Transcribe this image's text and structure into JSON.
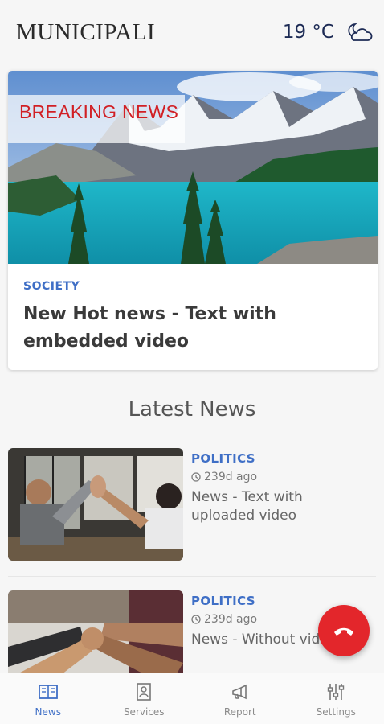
{
  "header": {
    "brand": "MUNICIPALI",
    "temperature": "19 °C",
    "weather_icon": "partly-cloudy-night-icon"
  },
  "hero": {
    "badge": "BREAKING NEWS",
    "category": "SOCIETY",
    "title": "New Hot news - Text with embedded video",
    "image": "mountain-lake-photo"
  },
  "latest": {
    "heading": "Latest News",
    "items": [
      {
        "category": "POLITICS",
        "time": "239d ago",
        "title": "News - Text with uploaded video",
        "image": "team-high-five-photo"
      },
      {
        "category": "POLITICS",
        "time": "239d ago",
        "title": "News - Without video",
        "image": "fist-bump-photo"
      }
    ]
  },
  "fab": {
    "icon": "phone-hangup-icon",
    "color": "#e3262b"
  },
  "nav": {
    "items": [
      {
        "label": "News",
        "icon": "newspaper-icon",
        "active": true
      },
      {
        "label": "Services",
        "icon": "contact-card-icon",
        "active": false
      },
      {
        "label": "Report",
        "icon": "megaphone-icon",
        "active": false
      },
      {
        "label": "Settings",
        "icon": "sliders-icon",
        "active": false
      }
    ]
  },
  "colors": {
    "accent": "#3f6fc6",
    "breaking": "#d11f24",
    "background": "#f6f6f6"
  }
}
